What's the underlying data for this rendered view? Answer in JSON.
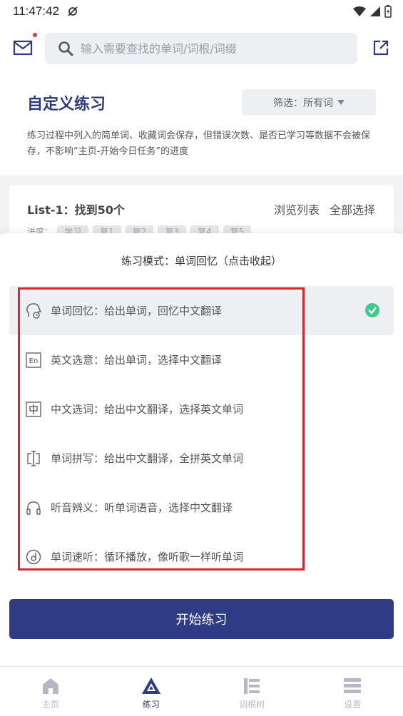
{
  "status_bar": {
    "time": "11:47:42"
  },
  "search": {
    "placeholder": "输入需要查找的单词/词根/词缀"
  },
  "page": {
    "title": "自定义练习",
    "filter_label": "筛选：所有词",
    "description": "练习过程中列入的简单词、收藏词会保存，但错误次数、是否已学习等数据不会被保存，不影响“主页-开始今日任务”的进度"
  },
  "list": {
    "title": "List-1：找到50个",
    "browse": "浏览列表",
    "select_all": "全部选择",
    "progress_label": "进度：",
    "progress_tags": [
      "学习",
      "复1",
      "复2",
      "复3",
      "复4",
      "复5"
    ]
  },
  "sheet": {
    "title": "练习模式：单词回忆（点击收起）",
    "modes": [
      {
        "label": "单词回忆：给出单词，回忆中文翻译",
        "icon": "head-recall-icon"
      },
      {
        "label": "英文选意：给出单词，选择中文翻译",
        "icon": "en-box-icon"
      },
      {
        "label": "中文选词：给出中文翻译，选择英文单词",
        "icon": "zh-box-icon"
      },
      {
        "label": "单词拼写：给出中文翻译，全拼英文单词",
        "icon": "text-cursor-icon"
      },
      {
        "label": "听音辨义：听单词语音，选择中文翻译",
        "icon": "headphones-icon"
      },
      {
        "label": "单词速听：循环播放，像听歌一样听单词",
        "icon": "disc-icon"
      }
    ]
  },
  "start_button": "开始练习",
  "tabs": [
    {
      "label": "主页",
      "icon": "home-icon"
    },
    {
      "label": "练习",
      "icon": "practice-icon"
    },
    {
      "label": "词根树",
      "icon": "tree-icon"
    },
    {
      "label": "设置",
      "icon": "menu-icon"
    }
  ],
  "colors": {
    "brand": "#2f3b84",
    "title": "#2e3a7e",
    "check": "#3ec98a",
    "highlight": "#e0222b",
    "notification_dot": "#e8353c"
  }
}
